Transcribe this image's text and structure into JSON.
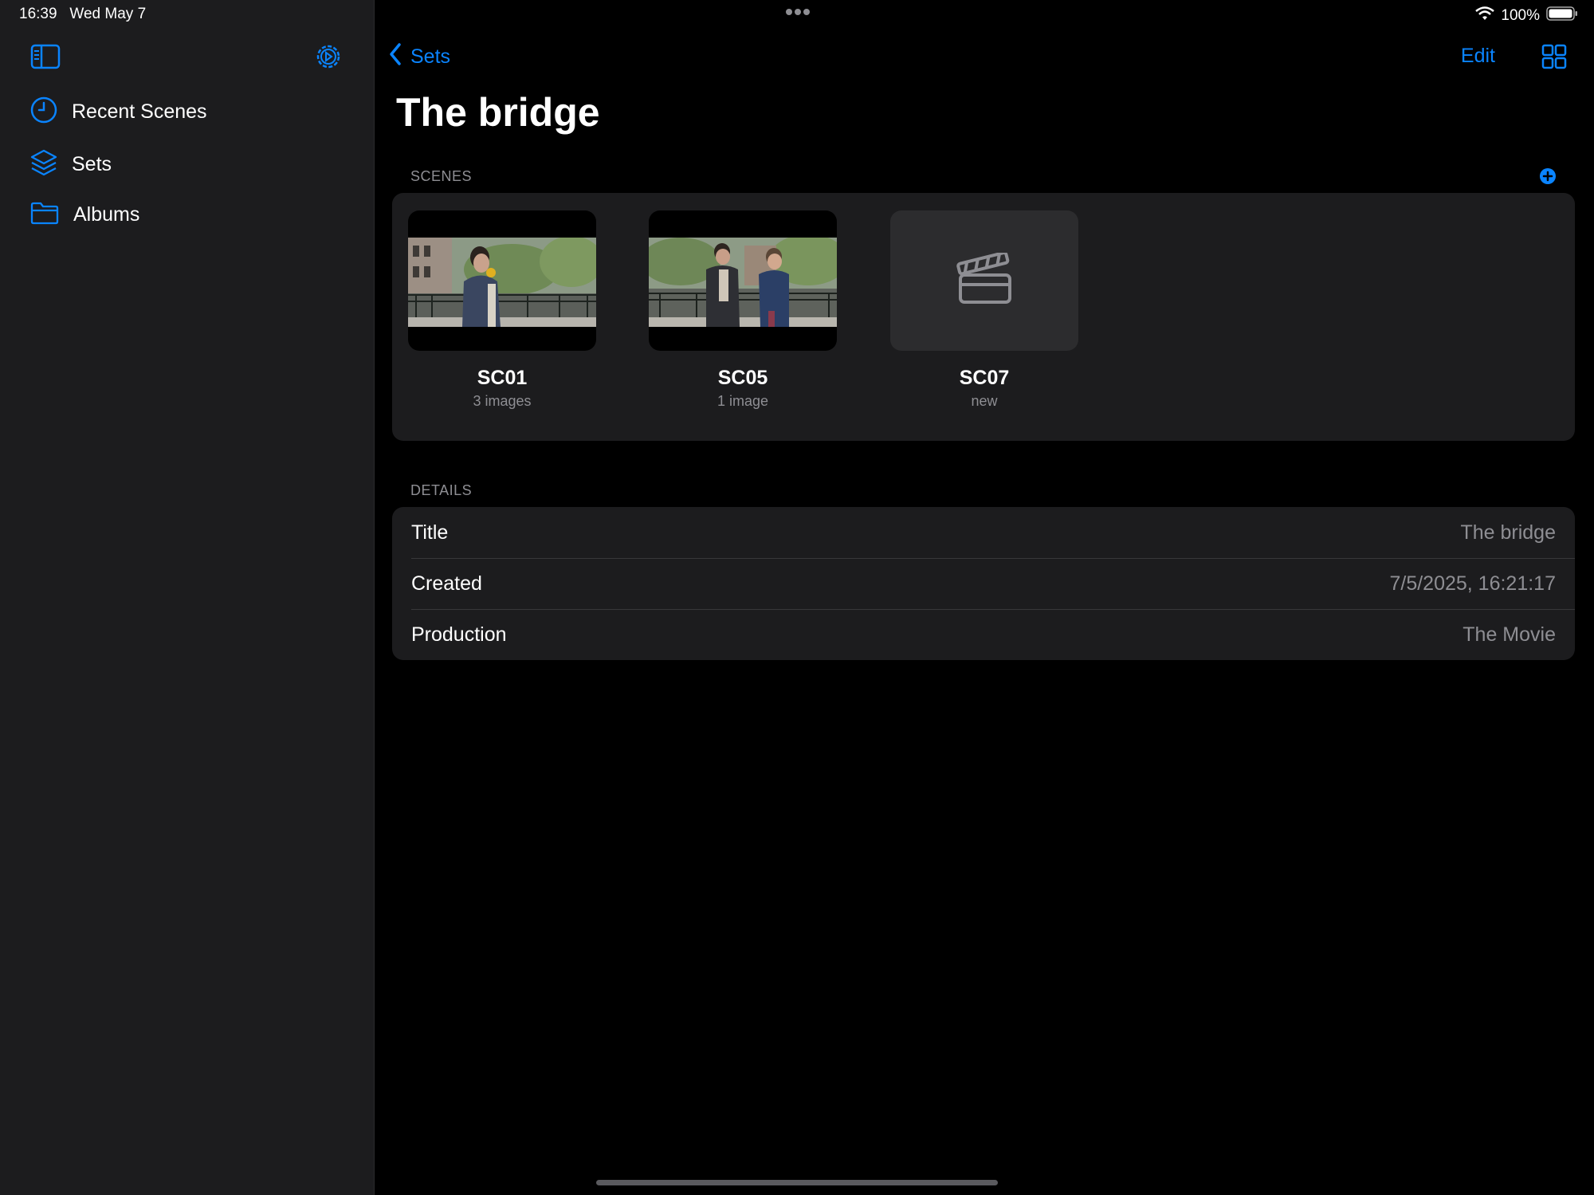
{
  "status_bar": {
    "time": "16:39",
    "date": "Wed May 7",
    "battery": "100%"
  },
  "sidebar": {
    "items": [
      {
        "label": "Recent Scenes",
        "icon": "clock-icon"
      },
      {
        "label": "Sets",
        "icon": "layers-icon"
      },
      {
        "label": "Albums",
        "icon": "folder-icon"
      }
    ]
  },
  "nav": {
    "back_label": "Sets",
    "edit_label": "Edit"
  },
  "page": {
    "title": "The bridge"
  },
  "scenes": {
    "header": "SCENES",
    "items": [
      {
        "name": "SC01",
        "subtitle": "3 images"
      },
      {
        "name": "SC05",
        "subtitle": "1 image"
      },
      {
        "name": "SC07",
        "subtitle": "new"
      }
    ]
  },
  "details": {
    "header": "DETAILS",
    "rows": [
      {
        "key": "Title",
        "value": "The bridge"
      },
      {
        "key": "Created",
        "value": "7/5/2025, 16:21:17"
      },
      {
        "key": "Production",
        "value": "The Movie"
      }
    ]
  },
  "colors": {
    "accent": "#0a84ff",
    "sidebar_bg": "#1c1c1e",
    "card_bg": "#1c1c1e",
    "secondary_text": "#8e8e93"
  }
}
